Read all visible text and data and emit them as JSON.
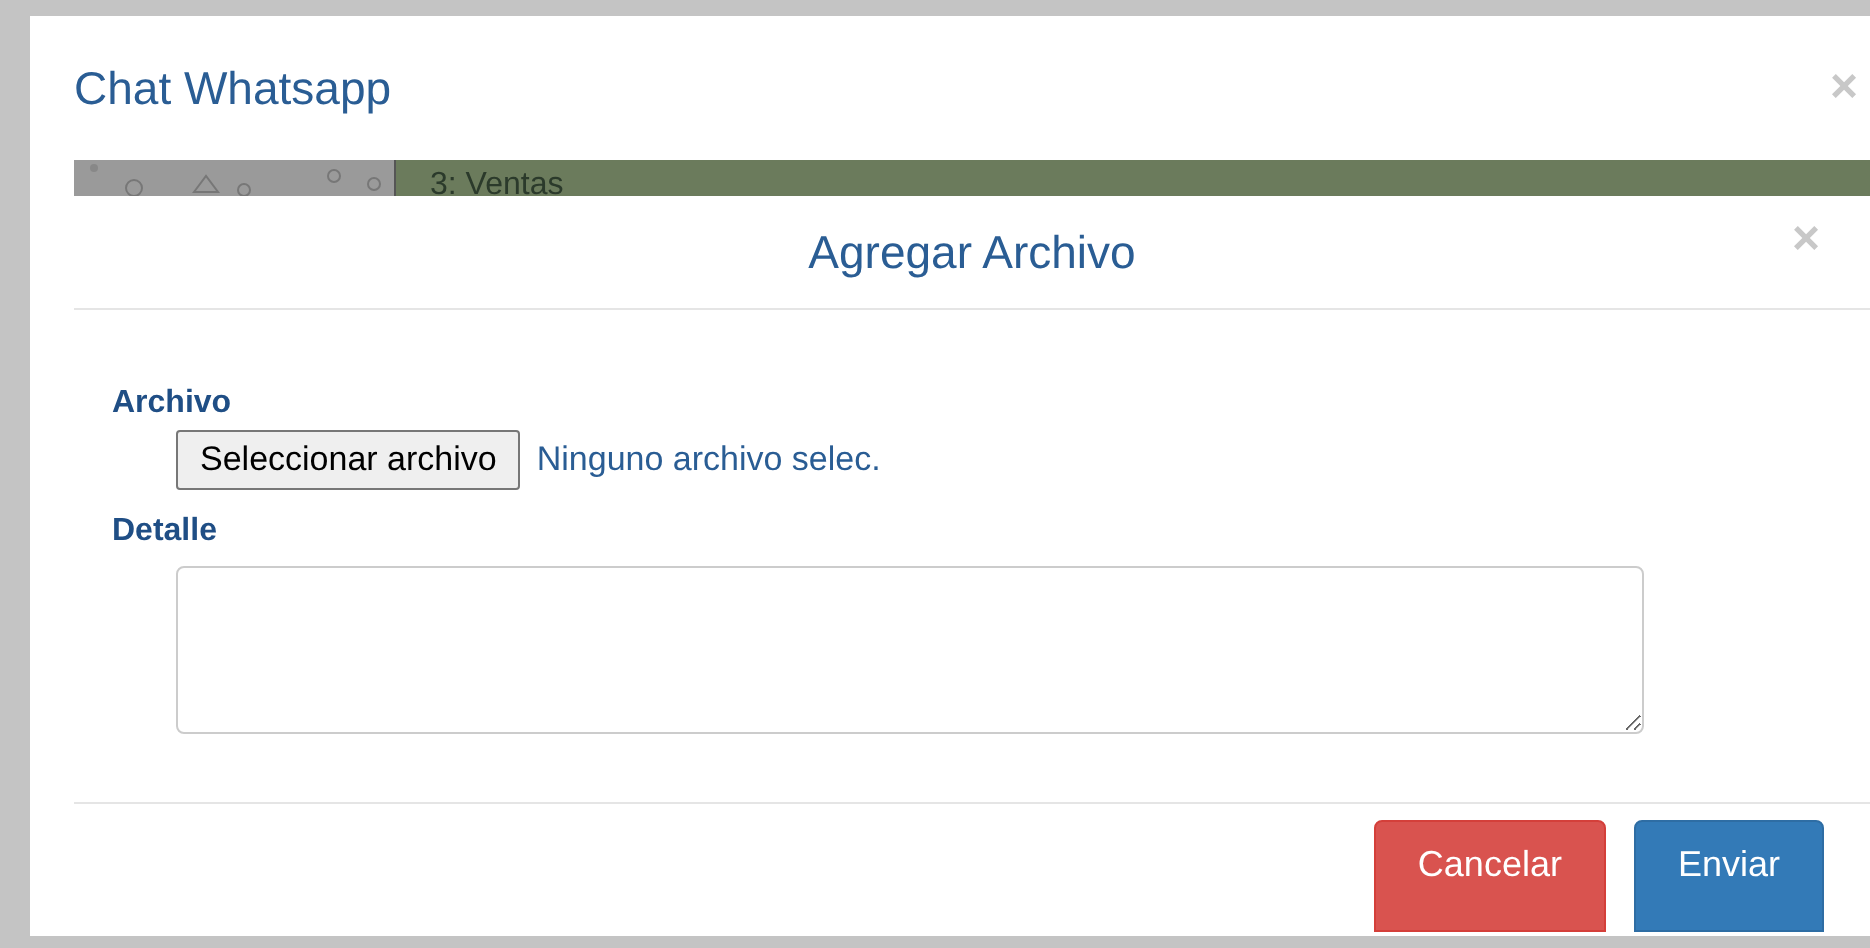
{
  "outer_dialog": {
    "title": "Chat Whatsapp",
    "close": "×",
    "chat_header": {
      "contact": "3: Ventas"
    }
  },
  "modal": {
    "title": "Agregar Archivo",
    "close": "×",
    "fields": [
      {
        "kind": "file",
        "label": "Archivo",
        "button": "Seleccionar archivo",
        "status": "Ninguno archivo selec."
      },
      {
        "kind": "textarea",
        "label": "Detalle"
      }
    ],
    "buttons": [
      {
        "label": "Cancelar",
        "kind": "danger"
      },
      {
        "label": "Enviar",
        "kind": "primary"
      }
    ]
  }
}
